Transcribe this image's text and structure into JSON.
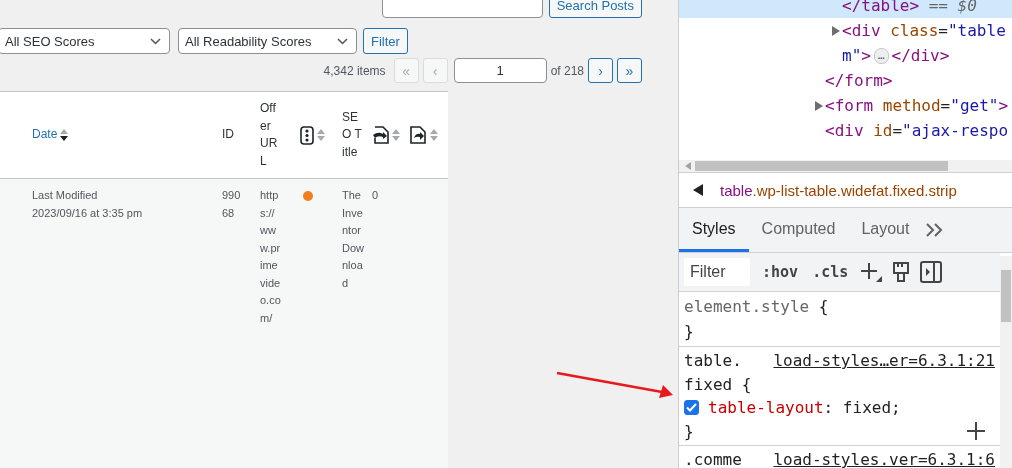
{
  "search": {
    "button": "Search Posts"
  },
  "filters": {
    "selects": [
      "All SEO Scores",
      "All Readability Scores"
    ],
    "button": "Filter"
  },
  "pagination": {
    "count": "4,342 items",
    "buttons_before": [
      {
        "label": "«",
        "disabled": true
      },
      {
        "label": "‹",
        "disabled": true
      }
    ],
    "page": "1",
    "total": "of 218",
    "buttons_after": [
      {
        "label": "›",
        "disabled": false
      },
      {
        "label": "»",
        "disabled": false
      }
    ]
  },
  "table": {
    "columns": [
      {
        "kind": "text",
        "label": "Date",
        "sortable": true,
        "sorted": true
      },
      {
        "kind": "text",
        "label": "ID",
        "sortable": false
      },
      {
        "kind": "text",
        "label": "Offer URL",
        "sortable": false
      },
      {
        "kind": "score",
        "sortable": true,
        "sorted": false
      },
      {
        "kind": "text",
        "label": "SEO Title",
        "sortable": false
      },
      {
        "kind": "inlinks",
        "sortable": true,
        "sorted": false
      },
      {
        "kind": "outlinks",
        "sortable": true,
        "sorted": false
      }
    ],
    "rows": [
      {
        "cells": [
          {
            "kind": "lines",
            "lines": [
              "Last Modified",
              "2023/09/16 at 3:35 pm"
            ]
          },
          {
            "kind": "text",
            "text": "99068"
          },
          {
            "kind": "text",
            "text": "https://www.primevideo.com/"
          },
          {
            "kind": "dot",
            "color": "#f0801f"
          },
          {
            "kind": "text",
            "text": "The Inventor Download"
          },
          {
            "kind": "text",
            "text": "0"
          }
        ]
      }
    ]
  },
  "devtools": {
    "dom_tree": [
      {
        "children": [
          {
            "selected": true,
            "expandable": false,
            "parts": [
              {
                "kind": "tag",
                "text": "</table>"
              },
              {
                "kind": "marker",
                "text": " == $0"
              }
            ]
          },
          {
            "selected": false,
            "expandable": true,
            "expanded": false,
            "parts": [
              {
                "kind": "tag",
                "text": "<div"
              },
              {
                "kind": "attr",
                "text": " class"
              },
              {
                "kind": "plain",
                "text": "="
              },
              {
                "kind": "value",
                "text": "\"table"
              }
            ],
            "continuation": [
              {
                "kind": "value",
                "text": "m\""
              },
              {
                "kind": "tag",
                "text": ">"
              },
              {
                "kind": "badge",
                "text": "…"
              },
              {
                "kind": "tag",
                "text": "</div>"
              }
            ]
          }
        ]
      },
      {
        "selected": false,
        "expandable": false,
        "parts": [
          {
            "kind": "tag",
            "text": "</form>"
          }
        ]
      },
      {
        "selected": false,
        "expandable": true,
        "expanded": false,
        "parts": [
          {
            "kind": "tag",
            "text": "<form"
          },
          {
            "kind": "attr",
            "text": " method"
          },
          {
            "kind": "plain",
            "text": "="
          },
          {
            "kind": "value",
            "text": "\"get\""
          },
          {
            "kind": "tag",
            "text": ">"
          }
        ]
      },
      {
        "selected": false,
        "expandable": false,
        "parts": [
          {
            "kind": "tag",
            "text": "<div"
          },
          {
            "kind": "attr",
            "text": " id"
          },
          {
            "kind": "plain",
            "text": "="
          },
          {
            "kind": "value",
            "text": "\"ajax-respo"
          }
        ]
      }
    ],
    "breadcrumb": [
      {
        "kind": "tag",
        "text": "table"
      },
      {
        "kind": "attr",
        "text": ".wp-list-table.widefat.fixed.strip"
      }
    ],
    "tabs": [
      {
        "label": "Styles",
        "selected": true
      },
      {
        "label": "Computed",
        "selected": false
      },
      {
        "label": "Layout",
        "selected": false
      }
    ],
    "toolbar": {
      "filter_placeholder": "Filter",
      "buttons": [
        ":hov",
        ".cls"
      ]
    },
    "rules": [
      {
        "inline": true,
        "selector": [
          "element.style"
        ],
        "open": "{",
        "close": "}"
      },
      {
        "inline": false,
        "selector": [
          "table.",
          "fixed"
        ],
        "source": "load-styles…er=6.3.1:21",
        "open": "{",
        "close": "}",
        "declarations": [
          {
            "property": "table-layout",
            "colon": ":",
            "value": "fixed;",
            "checked": true
          }
        ],
        "addable": true
      },
      {
        "inline": false,
        "selector": [
          ".comme"
        ],
        "source": "load-styles.ver=6.3.1:6"
      }
    ]
  }
}
